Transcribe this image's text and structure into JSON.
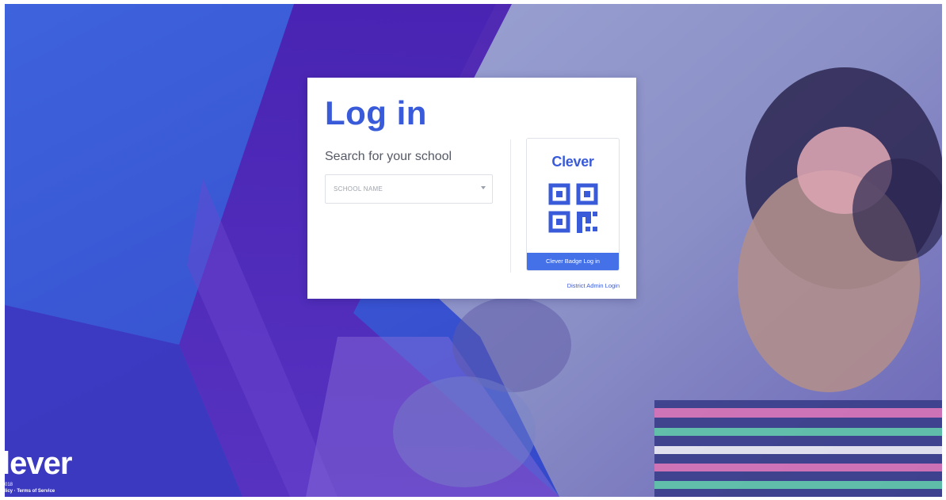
{
  "login": {
    "title": "Log in",
    "search_label": "Search for your school",
    "school_placeholder": "SCHOOL NAME"
  },
  "badge": {
    "brand": "Clever",
    "button_label": "Clever Badge Log in"
  },
  "links": {
    "district_admin": "District Admin Login"
  },
  "footer": {
    "logo": "lever",
    "year": "018",
    "links": "licy · Terms of Service"
  },
  "colors": {
    "brand_blue": "#3a5bd9",
    "button_blue": "#4470e8",
    "background_blue": "#2f4fc8",
    "background_purple": "#5a2ec2"
  },
  "icons": {
    "qr": "qr-code-icon",
    "dropdown": "chevron-down-icon"
  }
}
